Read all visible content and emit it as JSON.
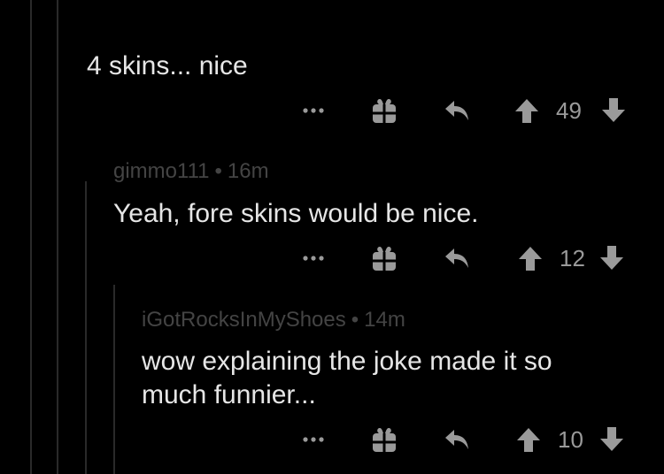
{
  "colors": {
    "background": "#000000",
    "text": "#e6e6e6",
    "meta": "#444444",
    "icon": "#9a9a9a",
    "thread_line": "#2a2a2a"
  },
  "comments": [
    {
      "author": "",
      "age": "",
      "body": "4 skins... nice",
      "score": "49"
    },
    {
      "author": "gimmo111",
      "age": "16m",
      "body": "Yeah, fore skins would be nice.",
      "score": "12"
    },
    {
      "author": "iGotRocksInMyShoes",
      "age": "14m",
      "body": "wow explaining the joke made it so\nmuch funnier...",
      "score": "10"
    }
  ],
  "meta_separator": "•",
  "icons": {
    "more": "more-dots-icon",
    "award": "gift-award-icon",
    "reply": "reply-arrow-icon",
    "upvote": "upvote-arrow-icon",
    "downvote": "downvote-arrow-icon"
  }
}
